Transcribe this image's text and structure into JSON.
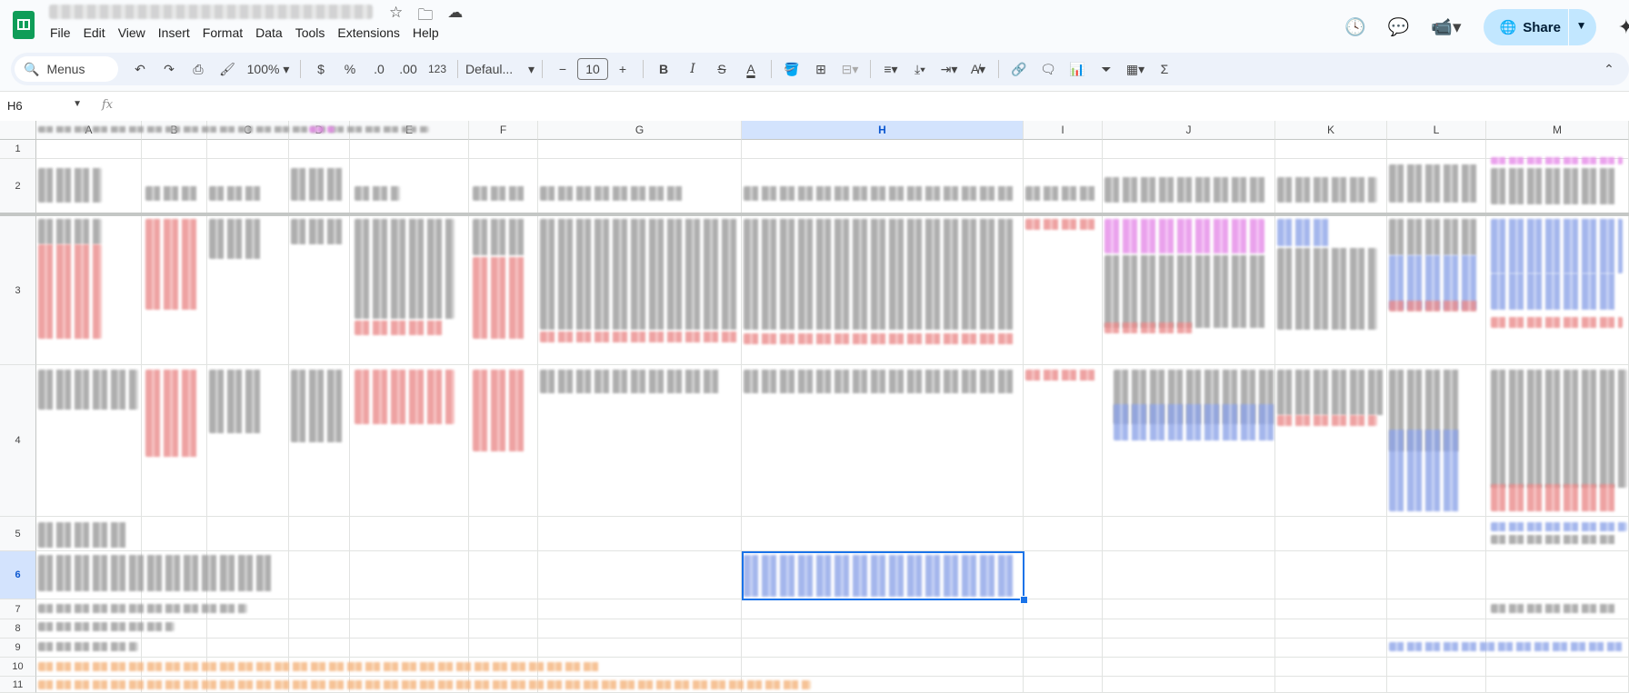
{
  "app": {
    "name": "Google Sheets",
    "title_icons": [
      "star-icon",
      "move-folder-icon",
      "cloud-status-icon"
    ]
  },
  "menu": [
    "File",
    "Edit",
    "View",
    "Insert",
    "Format",
    "Data",
    "Tools",
    "Extensions",
    "Help"
  ],
  "header_right": {
    "share_label": "Share",
    "icons": [
      "history-icon",
      "comments-icon",
      "meet-icon",
      "gemini-icon"
    ]
  },
  "toolbar": {
    "menus_label": "Menus",
    "zoom": "100%",
    "currency": "$",
    "percent": "%",
    "decrease_decimal": ".0",
    "increase_decimal": ".00",
    "number_format": "123",
    "font": "Defaul...",
    "font_size": "10",
    "minus": "−",
    "plus": "+",
    "bold": "B",
    "italic": "I",
    "strike": "S",
    "text_color": "A",
    "sigma": "Σ"
  },
  "formula_bar": {
    "cell_ref": "H6",
    "fx": "fx"
  },
  "columns": [
    "A",
    "B",
    "C",
    "D",
    "E",
    "F",
    "G",
    "H",
    "I",
    "J",
    "K",
    "L",
    "M"
  ],
  "rows": [
    "1",
    "2",
    "3",
    "4",
    "5",
    "6",
    "7",
    "8",
    "9",
    "10",
    "11"
  ],
  "selection": {
    "cell": "H6",
    "column": "H",
    "row": "6"
  },
  "colors": {
    "accent": "#1a73e8",
    "share_bg": "#c2e7ff",
    "header_sel": "#d3e3fd",
    "sheets_green": "#0f9d58"
  }
}
